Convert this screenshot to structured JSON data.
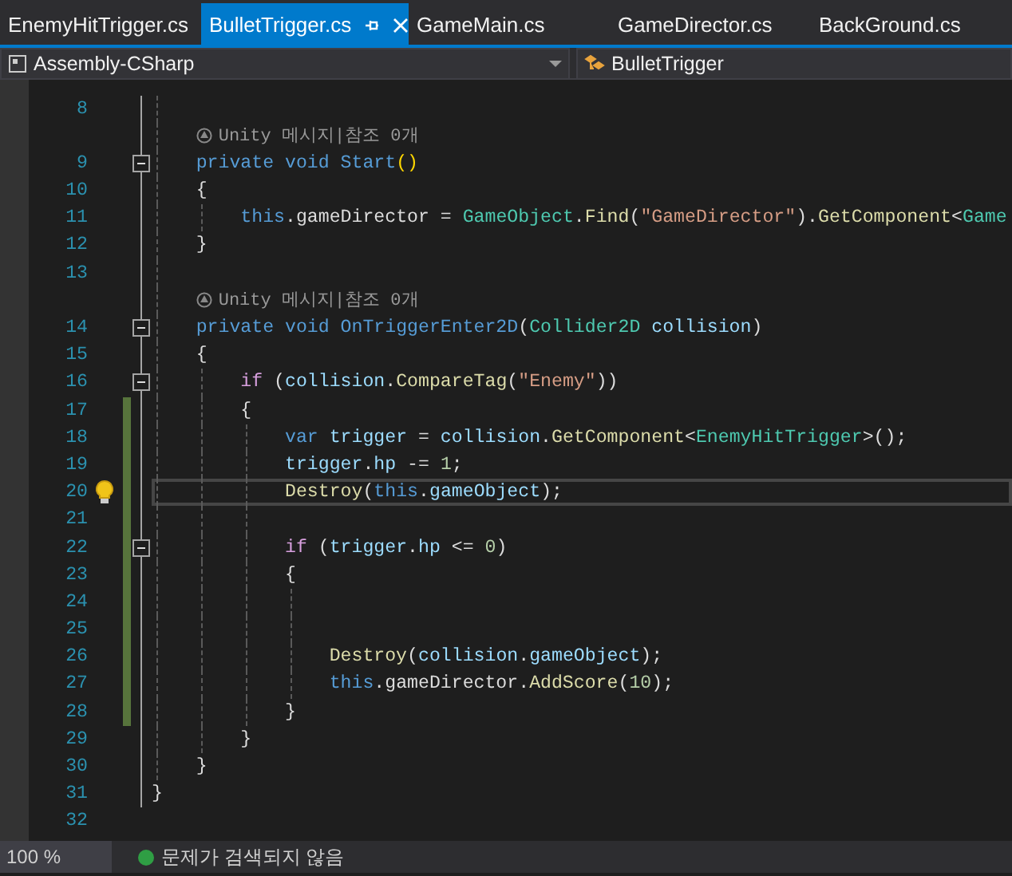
{
  "tabs": [
    {
      "label": "EnemyHitTrigger.cs",
      "selected": false
    },
    {
      "label": "BulletTrigger.cs",
      "selected": true
    },
    {
      "label": "GameMain.cs",
      "selected": false
    },
    {
      "label": "GameDirector.cs",
      "selected": false
    },
    {
      "label": "BackGround.cs",
      "selected": false
    }
  ],
  "navigation_bar": {
    "project": "Assembly-CSharp",
    "class": "BulletTrigger"
  },
  "editor": {
    "rows": [
      {
        "kind": "code",
        "number": "8",
        "changed": false,
        "collapsible": false,
        "lightbulb": false,
        "current": false,
        "tokens": []
      },
      {
        "kind": "codelens",
        "text": "    Unity 메시지|참조 0개"
      },
      {
        "kind": "code",
        "number": "9",
        "changed": false,
        "collapsible": true,
        "lightbulb": false,
        "current": false,
        "tokens": [
          {
            "kind": "keyword",
            "text": "    private void "
          },
          {
            "kind": "message",
            "text": "Start"
          },
          {
            "kind": "paren",
            "text": "()"
          }
        ]
      },
      {
        "kind": "code",
        "number": "10",
        "changed": false,
        "collapsible": false,
        "lightbulb": false,
        "current": false,
        "tokens": [
          {
            "kind": "plain",
            "text": "    {"
          }
        ]
      },
      {
        "kind": "code",
        "number": "11",
        "changed": false,
        "collapsible": false,
        "lightbulb": false,
        "current": false,
        "tokens": [
          {
            "kind": "keyword",
            "text": "        this"
          },
          {
            "kind": "plain",
            "text": ".gameDirector = "
          },
          {
            "kind": "type",
            "text": "GameObject"
          },
          {
            "kind": "plain",
            "text": "."
          },
          {
            "kind": "method",
            "text": "Find"
          },
          {
            "kind": "plain",
            "text": "("
          },
          {
            "kind": "string",
            "text": "\"GameDirector\""
          },
          {
            "kind": "plain",
            "text": ")."
          },
          {
            "kind": "method",
            "text": "GetComponent"
          },
          {
            "kind": "plain",
            "text": "<"
          },
          {
            "kind": "type",
            "text": "Game"
          }
        ]
      },
      {
        "kind": "code",
        "number": "12",
        "changed": false,
        "collapsible": false,
        "lightbulb": false,
        "current": false,
        "tokens": [
          {
            "kind": "plain",
            "text": "    }"
          }
        ]
      },
      {
        "kind": "code",
        "number": "13",
        "changed": false,
        "collapsible": false,
        "lightbulb": false,
        "current": false,
        "tokens": []
      },
      {
        "kind": "codelens",
        "text": "    Unity 메시지|참조 0개"
      },
      {
        "kind": "code",
        "number": "14",
        "changed": false,
        "collapsible": true,
        "lightbulb": false,
        "current": false,
        "tokens": [
          {
            "kind": "keyword",
            "text": "    private void "
          },
          {
            "kind": "message",
            "text": "OnTriggerEnter2D"
          },
          {
            "kind": "plain",
            "text": "("
          },
          {
            "kind": "type",
            "text": "Collider2D "
          },
          {
            "kind": "variable",
            "text": "collision"
          },
          {
            "kind": "plain",
            "text": ")"
          }
        ]
      },
      {
        "kind": "code",
        "number": "15",
        "changed": false,
        "collapsible": false,
        "lightbulb": false,
        "current": false,
        "tokens": [
          {
            "kind": "plain",
            "text": "    {"
          }
        ]
      },
      {
        "kind": "code",
        "number": "16",
        "changed": false,
        "collapsible": true,
        "lightbulb": false,
        "current": false,
        "tokens": [
          {
            "kind": "control",
            "text": "        if "
          },
          {
            "kind": "plain",
            "text": "("
          },
          {
            "kind": "variable",
            "text": "collision"
          },
          {
            "kind": "plain",
            "text": "."
          },
          {
            "kind": "method",
            "text": "CompareTag"
          },
          {
            "kind": "plain",
            "text": "("
          },
          {
            "kind": "string",
            "text": "\"Enemy\""
          },
          {
            "kind": "plain",
            "text": "))"
          }
        ]
      },
      {
        "kind": "code",
        "number": "17",
        "changed": true,
        "collapsible": false,
        "lightbulb": false,
        "current": false,
        "tokens": [
          {
            "kind": "plain",
            "text": "        {"
          }
        ]
      },
      {
        "kind": "code",
        "number": "18",
        "changed": true,
        "collapsible": false,
        "lightbulb": false,
        "current": false,
        "tokens": [
          {
            "kind": "keyword",
            "text": "            var "
          },
          {
            "kind": "variable",
            "text": "trigger"
          },
          {
            "kind": "plain",
            "text": " = "
          },
          {
            "kind": "variable",
            "text": "collision"
          },
          {
            "kind": "plain",
            "text": "."
          },
          {
            "kind": "method",
            "text": "GetComponent"
          },
          {
            "kind": "plain",
            "text": "<"
          },
          {
            "kind": "type",
            "text": "EnemyHitTrigger"
          },
          {
            "kind": "plain",
            "text": ">();"
          }
        ]
      },
      {
        "kind": "code",
        "number": "19",
        "changed": true,
        "collapsible": false,
        "lightbulb": false,
        "current": false,
        "tokens": [
          {
            "kind": "variable",
            "text": "            trigger"
          },
          {
            "kind": "plain",
            "text": "."
          },
          {
            "kind": "variable",
            "text": "hp"
          },
          {
            "kind": "plain",
            "text": " -= "
          },
          {
            "kind": "number",
            "text": "1"
          },
          {
            "kind": "plain",
            "text": ";"
          }
        ]
      },
      {
        "kind": "code",
        "number": "20",
        "changed": true,
        "collapsible": false,
        "lightbulb": true,
        "current": true,
        "tokens": [
          {
            "kind": "method",
            "text": "            Destroy"
          },
          {
            "kind": "plain",
            "text": "("
          },
          {
            "kind": "keyword",
            "text": "this"
          },
          {
            "kind": "plain",
            "text": "."
          },
          {
            "kind": "variable",
            "text": "gameObject"
          },
          {
            "kind": "plain",
            "text": ");"
          }
        ]
      },
      {
        "kind": "code",
        "number": "21",
        "changed": true,
        "collapsible": false,
        "lightbulb": false,
        "current": false,
        "tokens": []
      },
      {
        "kind": "code",
        "number": "22",
        "changed": true,
        "collapsible": true,
        "lightbulb": false,
        "current": false,
        "tokens": [
          {
            "kind": "control",
            "text": "            if "
          },
          {
            "kind": "plain",
            "text": "("
          },
          {
            "kind": "variable",
            "text": "trigger"
          },
          {
            "kind": "plain",
            "text": "."
          },
          {
            "kind": "variable",
            "text": "hp"
          },
          {
            "kind": "plain",
            "text": " <= "
          },
          {
            "kind": "number",
            "text": "0"
          },
          {
            "kind": "plain",
            "text": ")"
          }
        ]
      },
      {
        "kind": "code",
        "number": "23",
        "changed": true,
        "collapsible": false,
        "lightbulb": false,
        "current": false,
        "tokens": [
          {
            "kind": "plain",
            "text": "            {"
          }
        ]
      },
      {
        "kind": "code",
        "number": "24",
        "changed": true,
        "collapsible": false,
        "lightbulb": false,
        "current": false,
        "tokens": []
      },
      {
        "kind": "code",
        "number": "25",
        "changed": true,
        "collapsible": false,
        "lightbulb": false,
        "current": false,
        "tokens": []
      },
      {
        "kind": "code",
        "number": "26",
        "changed": true,
        "collapsible": false,
        "lightbulb": false,
        "current": false,
        "tokens": [
          {
            "kind": "method",
            "text": "                Destroy"
          },
          {
            "kind": "plain",
            "text": "("
          },
          {
            "kind": "variable",
            "text": "collision"
          },
          {
            "kind": "plain",
            "text": "."
          },
          {
            "kind": "variable",
            "text": "gameObject"
          },
          {
            "kind": "plain",
            "text": ");"
          }
        ]
      },
      {
        "kind": "code",
        "number": "27",
        "changed": true,
        "collapsible": false,
        "lightbulb": false,
        "current": false,
        "tokens": [
          {
            "kind": "keyword",
            "text": "                this"
          },
          {
            "kind": "plain",
            "text": ".gameDirector."
          },
          {
            "kind": "method",
            "text": "AddScore"
          },
          {
            "kind": "plain",
            "text": "("
          },
          {
            "kind": "number",
            "text": "10"
          },
          {
            "kind": "plain",
            "text": ");"
          }
        ]
      },
      {
        "kind": "code",
        "number": "28",
        "changed": true,
        "collapsible": false,
        "lightbulb": false,
        "current": false,
        "tokens": [
          {
            "kind": "plain",
            "text": "            }"
          }
        ]
      },
      {
        "kind": "code",
        "number": "29",
        "changed": false,
        "collapsible": false,
        "lightbulb": false,
        "current": false,
        "tokens": [
          {
            "kind": "plain",
            "text": "        }"
          }
        ]
      },
      {
        "kind": "code",
        "number": "30",
        "changed": false,
        "collapsible": false,
        "lightbulb": false,
        "current": false,
        "tokens": [
          {
            "kind": "plain",
            "text": "    }"
          }
        ]
      },
      {
        "kind": "code",
        "number": "31",
        "changed": false,
        "collapsible": false,
        "lightbulb": false,
        "current": false,
        "tokens": [
          {
            "kind": "plain",
            "text": "}"
          }
        ]
      },
      {
        "kind": "code",
        "number": "32",
        "changed": false,
        "collapsible": false,
        "lightbulb": false,
        "current": false,
        "tokens": []
      }
    ]
  },
  "status_bar": {
    "zoom": "100 %",
    "problems": "문제가 검색되지 않음"
  }
}
